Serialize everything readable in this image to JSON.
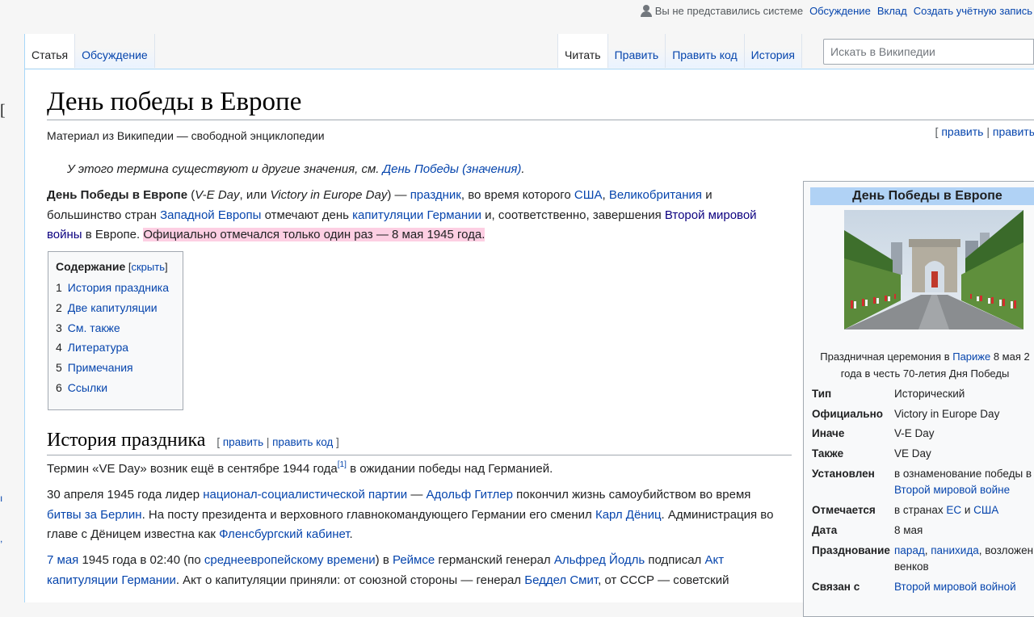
{
  "personal": {
    "user_status": "Вы не представились системе",
    "talk": "Обсуждение",
    "contributions": "Вклад",
    "create_account": "Создать учётную запись"
  },
  "tabs_left": [
    {
      "label": "Статья",
      "selected": true
    },
    {
      "label": "Обсуждение",
      "selected": false
    }
  ],
  "tabs_right": [
    {
      "label": "Читать",
      "selected": true
    },
    {
      "label": "Править",
      "selected": false
    },
    {
      "label": "Править код",
      "selected": false
    },
    {
      "label": "История",
      "selected": false
    }
  ],
  "search": {
    "placeholder": "Искать в Википедии"
  },
  "article": {
    "title": "День победы в Европе",
    "site_sub": "Материал из Википедии — свободной энциклопедии",
    "top_edit": {
      "open": "[ ",
      "edit": "править",
      "sep": " | ",
      "edit_code": "править"
    },
    "hatnote": {
      "text": "У этого термина существуют и другие значения, см. ",
      "link": "День Победы (значения)",
      "end": "."
    },
    "intro": {
      "bold": "День Победы в Европе",
      "p1": " (",
      "i1": "V-E Day",
      "p2": ", или ",
      "i2": "Victory in Europe Day",
      "p3": ") — ",
      "l_holiday": "праздник",
      "p4": ", во время которого ",
      "l_usa": "США",
      "p5": ", ",
      "l_uk": "Великобритания",
      "p6": " и большинство стран ",
      "l_west": "Западной Европы",
      "p7": " отмечают день ",
      "l_cap": "капитуляции Германии",
      "p8": " и, соответственно, завершения ",
      "l_ww2": "Второй мировой войны",
      "p9": " в Европе. ",
      "highlight": "Официально отмечался только один раз — 8 мая 1945 года."
    },
    "toc": {
      "title": "Содержание",
      "hide_open": " [",
      "hide": "скрыть",
      "hide_close": "]",
      "items": [
        {
          "num": "1",
          "label": "История праздника"
        },
        {
          "num": "2",
          "label": "Две капитуляции"
        },
        {
          "num": "3",
          "label": "См. также"
        },
        {
          "num": "4",
          "label": "Литература"
        },
        {
          "num": "5",
          "label": "Примечания"
        },
        {
          "num": "6",
          "label": "Ссылки"
        }
      ]
    },
    "section1": {
      "heading": "История праздника",
      "edit": {
        "open": "[ ",
        "edit": "править",
        "sep": " | ",
        "edit_code": "править код",
        "close": " ]"
      },
      "para1": {
        "a": "Термин «VE Day» возник ещё в сентябре 1944 года",
        "ref": "[1]",
        "b": " в ожидании победы над Германией."
      },
      "para2": {
        "a": "30 апреля 1945 года лидер ",
        "l1": "национал-социалистической партии",
        "b": " — ",
        "l2": "Адольф Гитлер",
        "c": " покончил жизнь самоубийством во время ",
        "l3": "битвы за Берлин",
        "d": ". На посту президента и верховного главнокомандующего Германии его сменил ",
        "l4": "Карл Дёниц",
        "e": ". Администрация во главе с Дёницем известна как ",
        "l5": "Фленсбургский кабинет",
        "f": "."
      },
      "para3": {
        "l1": "7 мая",
        "a": " 1945 года в 02:40 (по ",
        "l2": "среднеевропейскому времени",
        "b": ") в ",
        "l3": "Реймсе",
        "c": " германский генерал ",
        "l4": "Альфред Йодль",
        "d": " подписал ",
        "l5": "Акт капитуляции Германии",
        "e": ". Акт о капитуляции приняли: от союзной стороны — генерал ",
        "l6": "Беддел Смит",
        "f": ", от СССР — советский"
      }
    }
  },
  "infobox": {
    "title": "День Победы в Европе",
    "image_icon": "arc-de-triomphe-parade-photo",
    "caption": {
      "a": "Праздничная церемония в ",
      "link": "Париже",
      "b": " 8 мая 2",
      "line2": "года в честь 70-летия Дня Победы"
    },
    "rows": {
      "type": {
        "label": "Тип",
        "value": "Исторический"
      },
      "official": {
        "label": "Официально",
        "value": "Victory in Europe Day"
      },
      "other": {
        "label": "Иначе",
        "value": "V-E Day"
      },
      "also": {
        "label": "Также",
        "value": "VE Day"
      },
      "established": {
        "label": "Установлен",
        "value1": "в ознаменование победы в",
        "link": "Второй мировой войне"
      },
      "celebrated": {
        "label": "Отмечается",
        "a": "в странах ",
        "l1": "ЕС",
        "b": " и ",
        "l2": "США"
      },
      "date": {
        "label": "Дата",
        "value": "8 мая"
      },
      "celebration": {
        "label": "Празднование",
        "l1": "парад",
        "a": ", ",
        "l2": "панихида",
        "b": ", возложен",
        "line2": "венков"
      },
      "related": {
        "label": "Связан с",
        "link": "Второй мировой войной"
      }
    }
  },
  "colors": {
    "link": "#0645ad",
    "highlight": "#fdcfe3",
    "infobox_title": "#b0d2f5",
    "tab_border": "#a7d7f9"
  }
}
